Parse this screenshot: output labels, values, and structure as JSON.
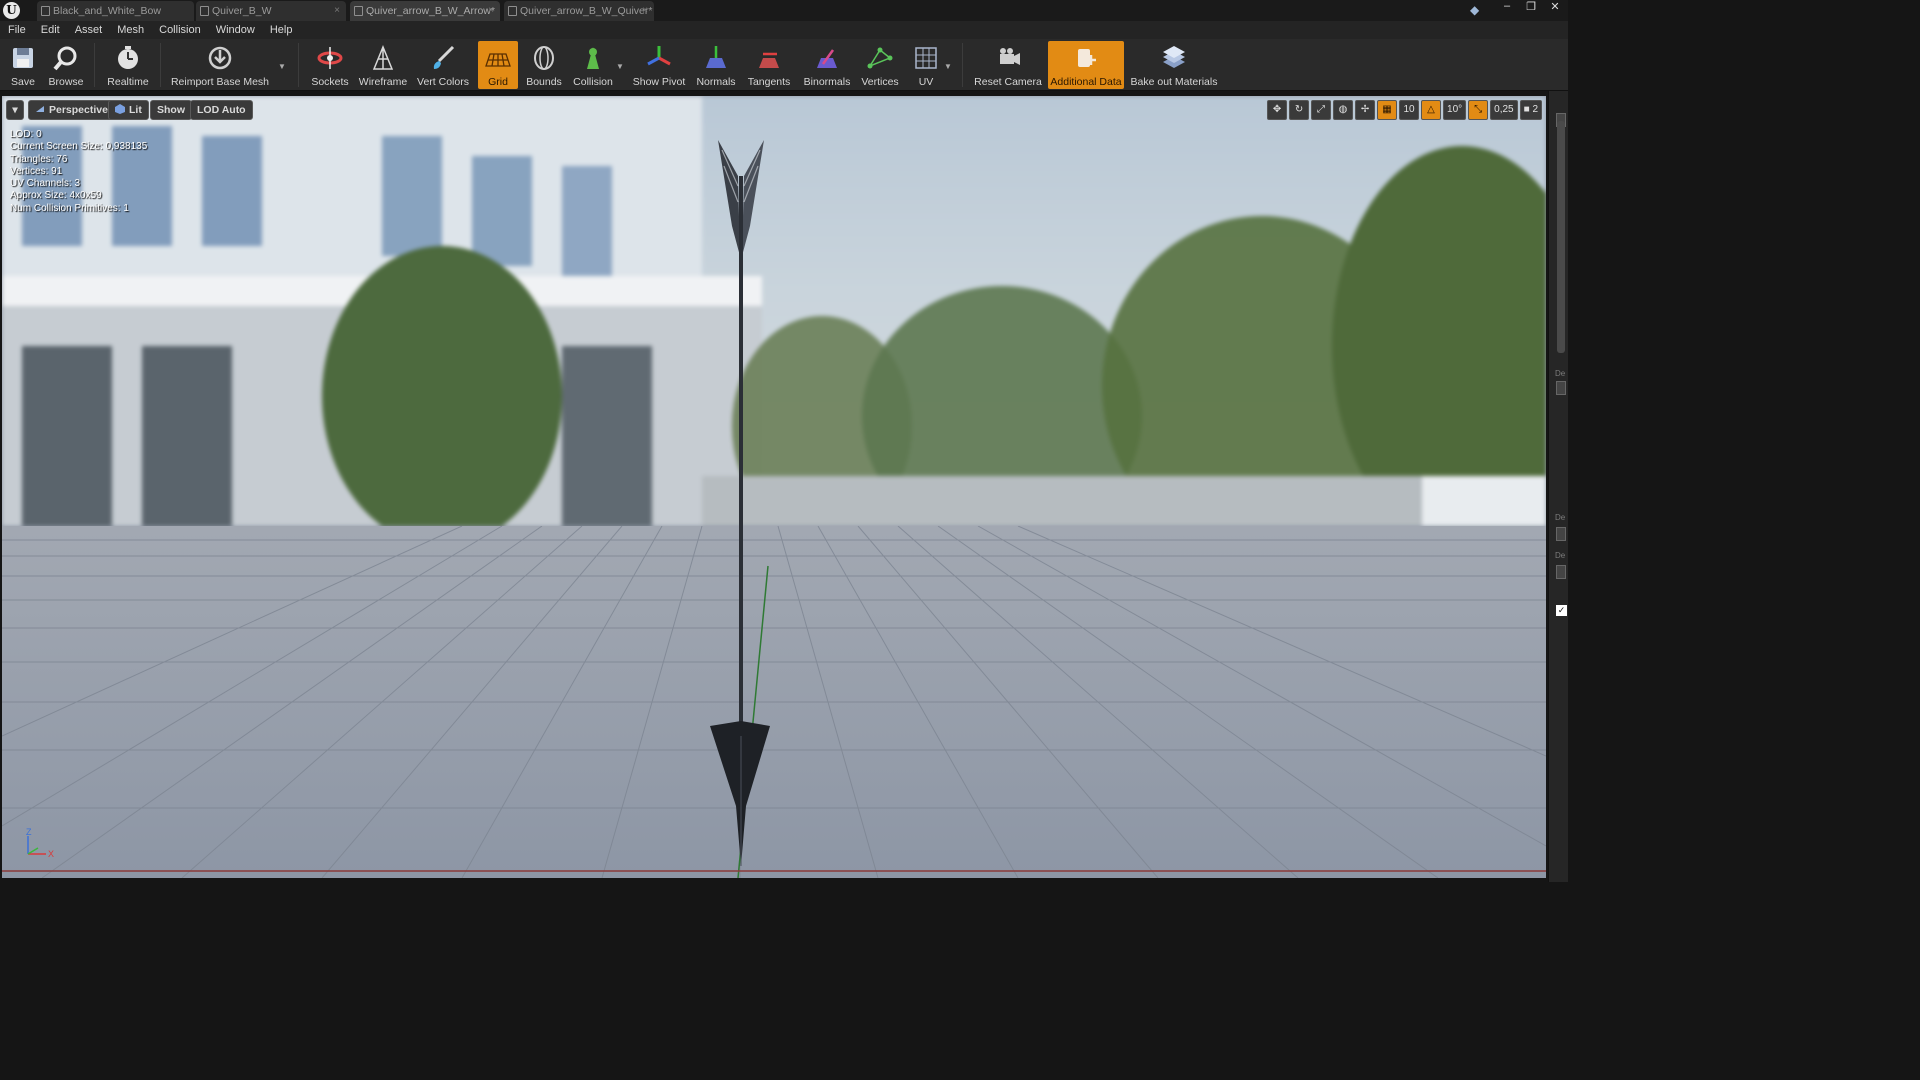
{
  "app": {
    "logo_letter": "U",
    "tabs": [
      {
        "label": "Black_and_White_Bow",
        "icon": "skeletal-mesh-icon",
        "active": false
      },
      {
        "label": "Quiver_B_W",
        "icon": "static-mesh-icon",
        "active": false
      },
      {
        "label": "Quiver_arrow_B_W_Arrow*",
        "icon": "static-mesh-icon",
        "active": true
      },
      {
        "label": "Quiver_arrow_B_W_Quiver*",
        "icon": "static-mesh-icon",
        "active": false
      }
    ],
    "window_controls": [
      "minimize-icon",
      "maximize-icon",
      "close-icon"
    ]
  },
  "menu": [
    "File",
    "Edit",
    "Asset",
    "Mesh",
    "Collision",
    "Window",
    "Help"
  ],
  "toolbar": {
    "buttons": [
      {
        "label": "Save",
        "icon": "save-icon",
        "active": false
      },
      {
        "label": "Browse",
        "icon": "browse-icon",
        "active": false
      },
      {
        "label": "Realtime",
        "icon": "realtime-icon",
        "active": false
      },
      {
        "label": "Reimport Base Mesh",
        "icon": "reimport-icon",
        "active": false
      },
      {
        "label": "Sockets",
        "icon": "sockets-icon",
        "active": false
      },
      {
        "label": "Wireframe",
        "icon": "wireframe-icon",
        "active": false
      },
      {
        "label": "Vert Colors",
        "icon": "vert-colors-icon",
        "active": false
      },
      {
        "label": "Grid",
        "icon": "grid-icon",
        "active": true
      },
      {
        "label": "Bounds",
        "icon": "bounds-icon",
        "active": false
      },
      {
        "label": "Collision",
        "icon": "collision-icon",
        "active": false
      },
      {
        "label": "Show Pivot",
        "icon": "pivot-icon",
        "active": false
      },
      {
        "label": "Normals",
        "icon": "normals-icon",
        "active": false
      },
      {
        "label": "Tangents",
        "icon": "tangents-icon",
        "active": false
      },
      {
        "label": "Binormals",
        "icon": "binormals-icon",
        "active": false
      },
      {
        "label": "Vertices",
        "icon": "vertices-icon",
        "active": false
      },
      {
        "label": "UV",
        "icon": "uv-icon",
        "active": false
      },
      {
        "label": "Reset Camera",
        "icon": "reset-camera-icon",
        "active": false
      },
      {
        "label": "Additional Data",
        "icon": "additional-data-icon",
        "active": true
      },
      {
        "label": "Bake out Materials",
        "icon": "bake-materials-icon",
        "active": false
      }
    ]
  },
  "viewport": {
    "buttons": {
      "perspective": "Perspective",
      "lit": "Lit",
      "show": "Show",
      "lod": "LOD Auto"
    },
    "right_controls": {
      "grid_snap": "10",
      "rotation_snap": "10°",
      "scale_snap": "0,25",
      "camera_speed": "2"
    },
    "stats": [
      "LOD:  0",
      "Current Screen Size:  0,938135",
      "Triangles:  76",
      "Vertices:  91",
      "UV Channels:  3",
      "Approx Size: 4x0x59",
      "Num Collision Primitives:  1"
    ],
    "axis": {
      "z": "Z",
      "x": "X"
    }
  },
  "colors": {
    "accent": "#e28b14",
    "toolbar_bg": "#2a2a2a",
    "menubar_bg": "#242424",
    "arrow": "#2b2f36"
  },
  "right_panel": {
    "labels": [
      "De",
      "De",
      "De"
    ]
  }
}
